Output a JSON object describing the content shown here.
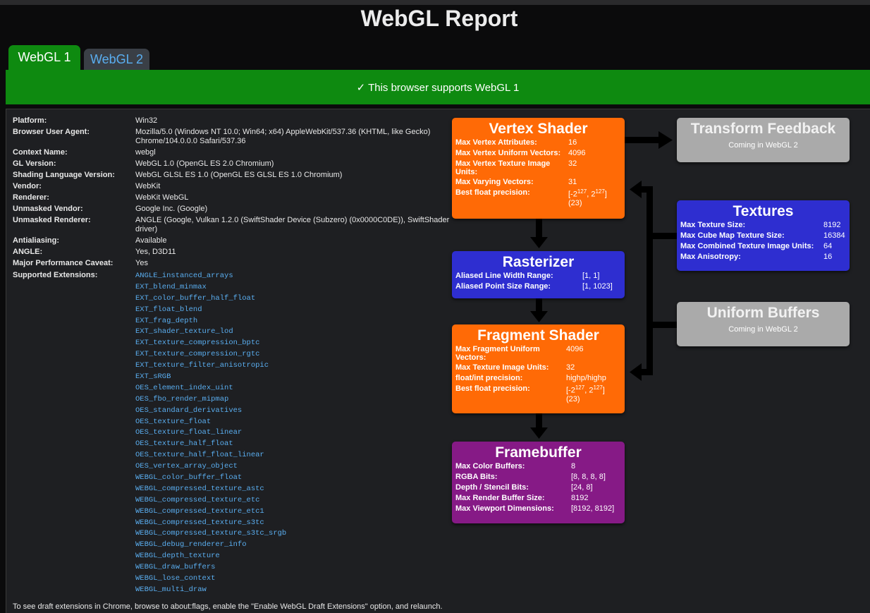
{
  "title": "WebGL Report",
  "tabs": [
    {
      "label": "WebGL 1",
      "active": true
    },
    {
      "label": "WebGL 2",
      "active": false
    }
  ],
  "banner": "✓ This browser supports WebGL 1",
  "info": [
    {
      "key": "Platform:",
      "value": "Win32"
    },
    {
      "key": "Browser User Agent:",
      "value": "Mozilla/5.0 (Windows NT 10.0; Win64; x64) AppleWebKit/537.36 (KHTML, like Gecko) Chrome/104.0.0.0 Safari/537.36"
    },
    {
      "key": "Context Name:",
      "value": "webgl"
    },
    {
      "key": "GL Version:",
      "value": "WebGL 1.0 (OpenGL ES 2.0 Chromium)"
    },
    {
      "key": "Shading Language Version:",
      "value": "WebGL GLSL ES 1.0 (OpenGL ES GLSL ES 1.0 Chromium)"
    },
    {
      "key": "Vendor:",
      "value": "WebKit"
    },
    {
      "key": "Renderer:",
      "value": "WebKit WebGL"
    },
    {
      "key": "Unmasked Vendor:",
      "value": "Google Inc. (Google)"
    },
    {
      "key": "Unmasked Renderer:",
      "value": "ANGLE (Google, Vulkan 1.2.0 (SwiftShader Device (Subzero) (0x0000C0DE)), SwiftShader driver)"
    },
    {
      "key": "Antialiasing:",
      "value": "Available"
    },
    {
      "key": "ANGLE:",
      "value": "Yes, D3D11"
    },
    {
      "key": "Major Performance Caveat:",
      "value": "Yes"
    }
  ],
  "extensions_label": "Supported Extensions:",
  "extensions": [
    "ANGLE_instanced_arrays",
    "EXT_blend_minmax",
    "EXT_color_buffer_half_float",
    "EXT_float_blend",
    "EXT_frag_depth",
    "EXT_shader_texture_lod",
    "EXT_texture_compression_bptc",
    "EXT_texture_compression_rgtc",
    "EXT_texture_filter_anisotropic",
    "EXT_sRGB",
    "OES_element_index_uint",
    "OES_fbo_render_mipmap",
    "OES_standard_derivatives",
    "OES_texture_float",
    "OES_texture_float_linear",
    "OES_texture_half_float",
    "OES_texture_half_float_linear",
    "OES_vertex_array_object",
    "WEBGL_color_buffer_float",
    "WEBGL_compressed_texture_astc",
    "WEBGL_compressed_texture_etc",
    "WEBGL_compressed_texture_etc1",
    "WEBGL_compressed_texture_s3tc",
    "WEBGL_compressed_texture_s3tc_srgb",
    "WEBGL_debug_renderer_info",
    "WEBGL_depth_texture",
    "WEBGL_draw_buffers",
    "WEBGL_lose_context",
    "WEBGL_multi_draw"
  ],
  "footnote": "To see draft extensions in Chrome, browse to about:flags, enable the \"Enable WebGL Draft Extensions\" option, and relaunch.",
  "vertex_shader": {
    "title": "Vertex Shader",
    "rows": [
      {
        "k": "Max Vertex Attributes:",
        "v": "16"
      },
      {
        "k": "Max Vertex Uniform Vectors:",
        "v": "4096"
      },
      {
        "k": "Max Vertex Texture Image Units:",
        "v": "32"
      },
      {
        "k": "Max Varying Vectors:",
        "v": "31"
      },
      {
        "k": "Best float precision:",
        "v": "[-2^127, 2^127] (23)"
      }
    ]
  },
  "rasterizer": {
    "title": "Rasterizer",
    "rows": [
      {
        "k": "Aliased Line Width Range:",
        "v": "[1, 1]"
      },
      {
        "k": "Aliased Point Size Range:",
        "v": "[1, 1023]"
      }
    ]
  },
  "fragment_shader": {
    "title": "Fragment Shader",
    "rows": [
      {
        "k": "Max Fragment Uniform Vectors:",
        "v": "4096"
      },
      {
        "k": "Max Texture Image Units:",
        "v": "32"
      },
      {
        "k": "float/int precision:",
        "v": "highp/highp"
      },
      {
        "k": "Best float precision:",
        "v": "[-2^127, 2^127] (23)"
      }
    ]
  },
  "framebuffer": {
    "title": "Framebuffer",
    "rows": [
      {
        "k": "Max Color Buffers:",
        "v": "8"
      },
      {
        "k": "RGBA Bits:",
        "v": "[8, 8, 8, 8]"
      },
      {
        "k": "Depth / Stencil Bits:",
        "v": "[24, 8]"
      },
      {
        "k": "Max Render Buffer Size:",
        "v": "8192"
      },
      {
        "k": "Max Viewport Dimensions:",
        "v": "[8192, 8192]"
      }
    ]
  },
  "transform_feedback": {
    "title": "Transform Feedback",
    "note": "Coming in WebGL 2"
  },
  "textures": {
    "title": "Textures",
    "rows": [
      {
        "k": "Max Texture Size:",
        "v": "8192"
      },
      {
        "k": "Max Cube Map Texture Size:",
        "v": "16384"
      },
      {
        "k": "Max Combined Texture Image Units:",
        "v": "64"
      },
      {
        "k": "Max Anisotropy:",
        "v": "16"
      }
    ]
  },
  "uniform_buffers": {
    "title": "Uniform Buffers",
    "note": "Coming in WebGL 2"
  },
  "colors": {
    "green": "#0e8a10",
    "orange": "#ff6a06",
    "blue": "#2e2ed0",
    "purple": "#861a86",
    "gray": "#aaaaaa",
    "link": "#5aaef0"
  }
}
